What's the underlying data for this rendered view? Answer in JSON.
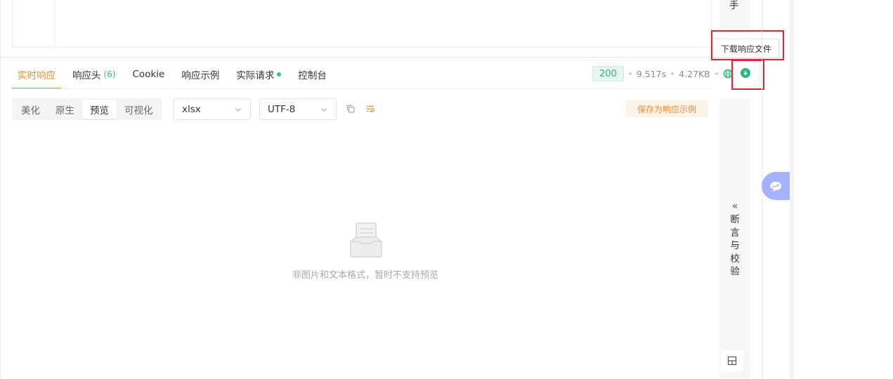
{
  "top_side": {
    "char": "手"
  },
  "tabs": [
    {
      "label": "实时响应"
    },
    {
      "label": "响应头",
      "count": "(6)"
    },
    {
      "label": "Cookie"
    },
    {
      "label": "响应示例"
    },
    {
      "label": "实际请求"
    },
    {
      "label": "控制台"
    }
  ],
  "meta": {
    "status": "200",
    "time": "9.517s",
    "size": "4.27KB"
  },
  "tooltip": "下载响应文件",
  "view_modes": [
    "美化",
    "原生",
    "预览",
    "可视化"
  ],
  "selects": {
    "type": "xlsx",
    "encoding": "UTF-8"
  },
  "save_example": "保存为响应示例",
  "empty_message": "非图片和文本格式，暂时不支持预览",
  "side_panel": {
    "collapse": "«",
    "chars": [
      "断",
      "言",
      "与",
      "校",
      "验"
    ]
  },
  "colors": {
    "accent": "#ea8a2a",
    "success": "#2fb67c",
    "highlight": "#e8222b",
    "float": "#a5b2ff"
  },
  "icons": [
    "globe-icon",
    "download-icon",
    "copy-icon",
    "wrap-icon",
    "chevron-down-icon",
    "empty-box-icon",
    "layout-icon",
    "bot-icon"
  ]
}
